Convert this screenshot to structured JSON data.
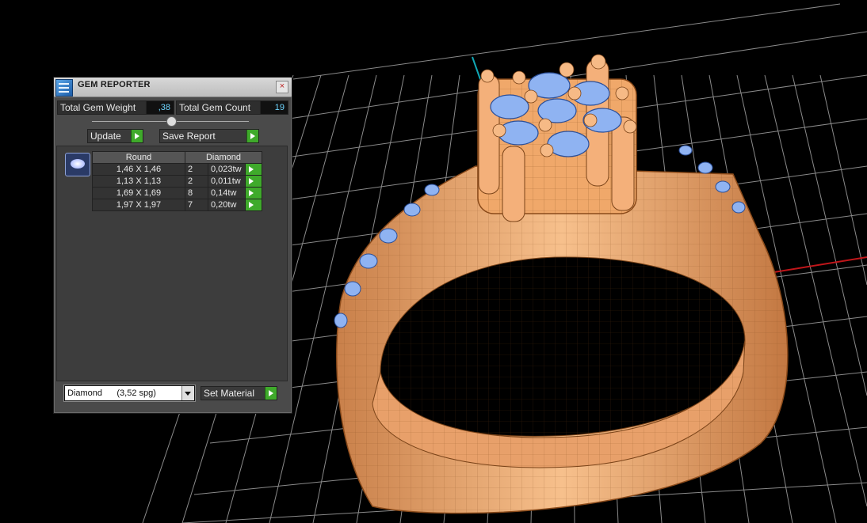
{
  "panel": {
    "title": "GEM REPORTER",
    "close_glyph": "×",
    "total_gem_weight_label": "Total Gem Weight",
    "total_gem_weight_value": ",38",
    "total_gem_count_label": "Total Gem Count",
    "total_gem_count_value": "19",
    "update_label": "Update",
    "save_report_label": "Save Report",
    "table": {
      "headers": [
        "Round",
        "Diamond"
      ],
      "rows": [
        {
          "size": "1,46 X 1,46",
          "count": "2",
          "weight": "0,023tw"
        },
        {
          "size": "1,13 X 1,13",
          "count": "2",
          "weight": "0,011tw"
        },
        {
          "size": "1,69 X 1,69",
          "count": "8",
          "weight": "0,14tw"
        },
        {
          "size": "1,97 X 1,97",
          "count": "7",
          "weight": "0,20tw"
        }
      ]
    },
    "material_select": "Diamond      (3,52 spg)",
    "set_material_label": "Set Material"
  },
  "colors": {
    "metal": "#f0a86a",
    "metal_wire": "#7a4318",
    "gem": "#8fb3f2",
    "grid": "#8a8a8a",
    "accent_green": "#3faa2b",
    "value_text": "#6fd6ff"
  }
}
